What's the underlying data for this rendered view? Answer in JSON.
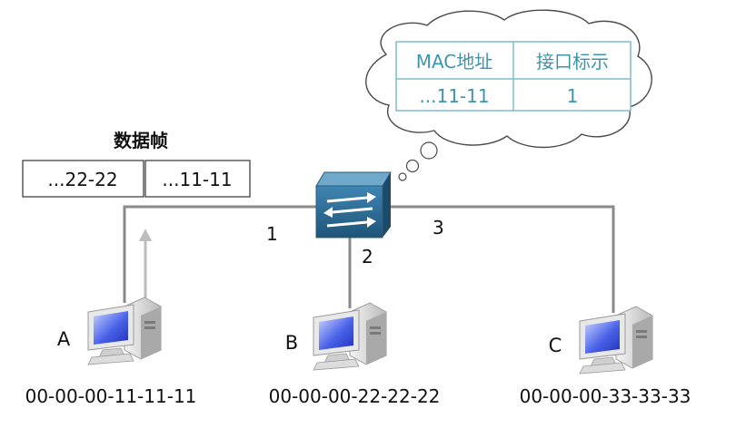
{
  "frame": {
    "title": "数据帧",
    "fields": [
      "...22-22",
      "...11-11"
    ]
  },
  "mac_table": {
    "headers": [
      "MAC地址",
      "接口标示"
    ],
    "rows": [
      [
        "...11-11",
        "1"
      ]
    ]
  },
  "switch": {
    "ports": [
      "1",
      "2",
      "3"
    ]
  },
  "hosts": [
    {
      "label": "A",
      "mac": "00-00-00-11-11-11"
    },
    {
      "label": "B",
      "mac": "00-00-00-22-22-22"
    },
    {
      "label": "C",
      "mac": "00-00-00-33-33-33"
    }
  ],
  "colors": {
    "line": "#8a8a8a",
    "arrow": "#bdbdbd",
    "table_border": "#7fbccc",
    "table_text": "#3c95ad",
    "switch_body": "#2f6f96",
    "switch_top": "#6fa8c9"
  }
}
